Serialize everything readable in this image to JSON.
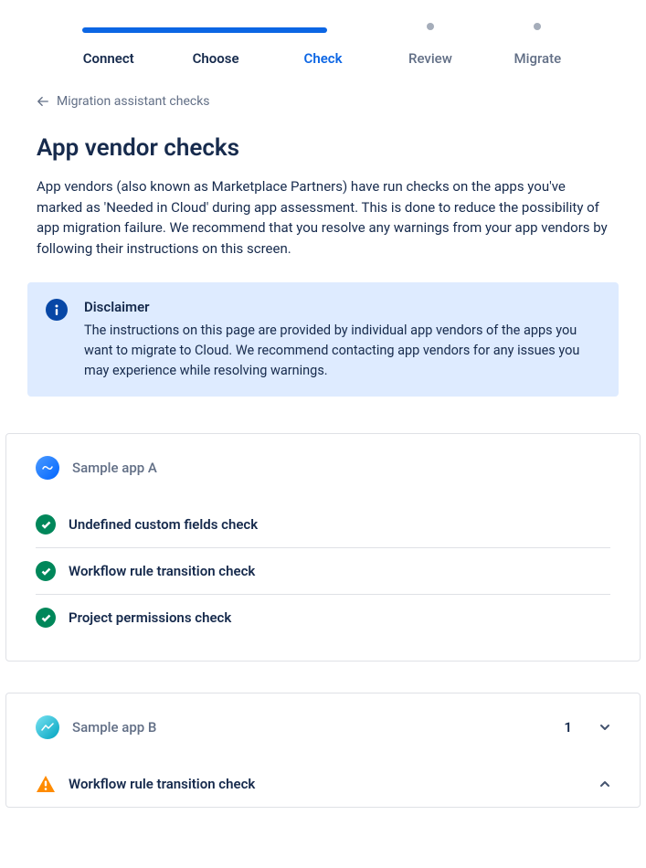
{
  "stepper": {
    "steps": [
      {
        "label": "Connect",
        "state": "done"
      },
      {
        "label": "Choose",
        "state": "done"
      },
      {
        "label": "Check",
        "state": "current"
      },
      {
        "label": "Review",
        "state": "upcoming"
      },
      {
        "label": "Migrate",
        "state": "upcoming"
      }
    ]
  },
  "back_link": "Migration assistant checks",
  "page_title": "App vendor checks",
  "intro_text": "App vendors (also known as Marketplace Partners) have run checks on the apps you've marked as 'Needed in Cloud' during app assessment. This is done to reduce the possibility of app migration failure. We recommend that you resolve any warnings from your app vendors by following their instructions on this screen.",
  "disclaimer": {
    "title": "Disclaimer",
    "body": "The instructions on this page are provided by individual app vendors of the apps you want to migrate to Cloud.  We recommend contacting app vendors for any issues you may experience while resolving warnings."
  },
  "apps": [
    {
      "name": "Sample app A",
      "icon": "blue",
      "warning_count": null,
      "expanded": true,
      "checks": [
        {
          "title": "Undefined custom fields check",
          "status": "success"
        },
        {
          "title": "Workflow rule transition check",
          "status": "success"
        },
        {
          "title": "Project permissions check",
          "status": "success"
        }
      ]
    },
    {
      "name": "Sample app B",
      "icon": "teal",
      "warning_count": "1",
      "expanded": true,
      "checks": [
        {
          "title": "Workflow rule transition check",
          "status": "warning"
        }
      ]
    }
  ]
}
